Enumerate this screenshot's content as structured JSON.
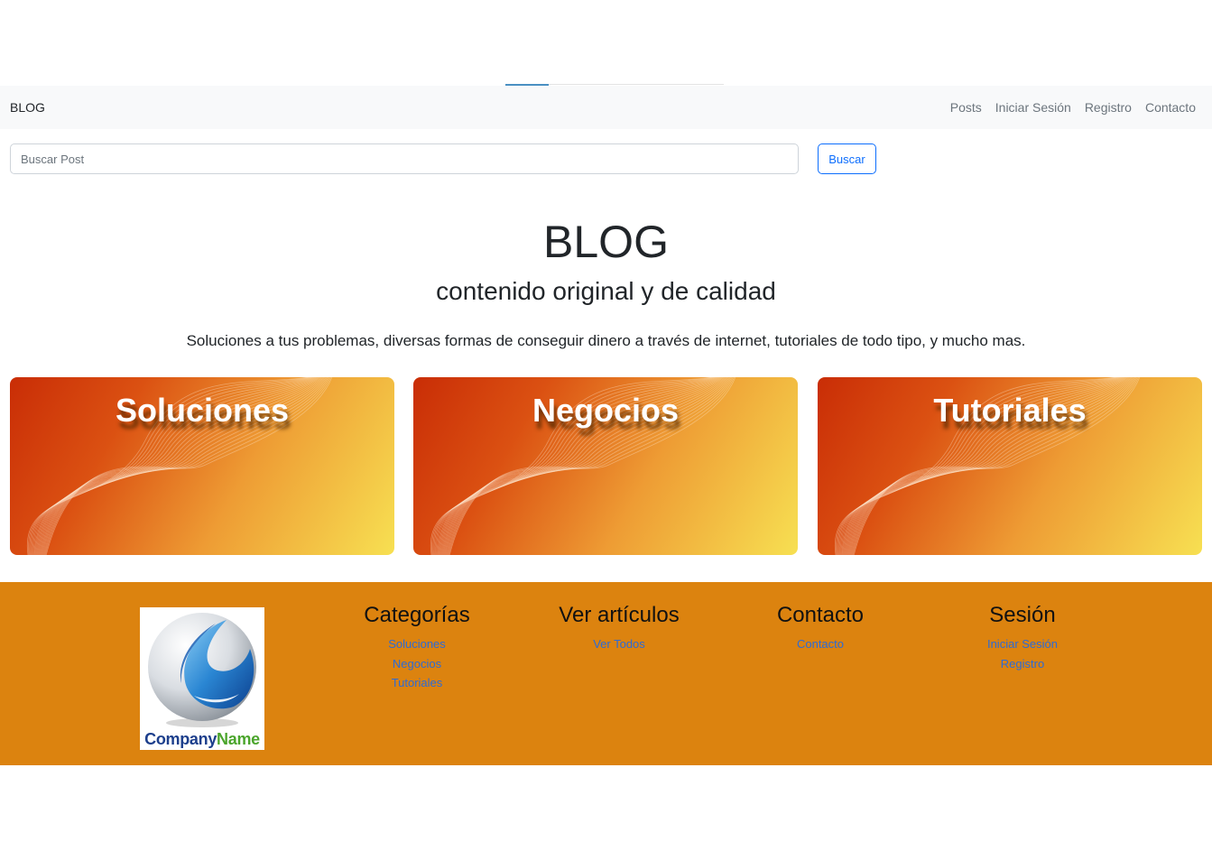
{
  "navbar": {
    "brand": "BLOG",
    "links": [
      "Posts",
      "Iniciar Sesión",
      "Registro",
      "Contacto"
    ]
  },
  "search": {
    "placeholder": "Buscar Post",
    "button_label": "Buscar"
  },
  "hero": {
    "title": "BLOG",
    "subtitle": "contenido original y de calidad",
    "description": "Soluciones a tus problemas, diversas formas de conseguir dinero a través de internet, tutoriales de todo tipo, y mucho mas."
  },
  "cards": [
    {
      "title": "Soluciones"
    },
    {
      "title": "Negocios"
    },
    {
      "title": "Tutoriales"
    }
  ],
  "footer": {
    "logo": {
      "part1": "Company",
      "part2": "Name"
    },
    "columns": [
      {
        "heading": "Categorías",
        "links": [
          "Soluciones",
          "Negocios",
          "Tutoriales"
        ]
      },
      {
        "heading": "Ver artículos",
        "links": [
          "Ver Todos"
        ]
      },
      {
        "heading": "Contacto",
        "links": [
          "Contacto"
        ]
      },
      {
        "heading": "Sesión",
        "links": [
          "Iniciar Sesión",
          "Registro"
        ]
      }
    ]
  },
  "colors": {
    "navbar_bg": "#f8f9fa",
    "footer_bg": "#dc830f",
    "primary": "#0d6efd",
    "footer_link": "#2d6bd6"
  }
}
